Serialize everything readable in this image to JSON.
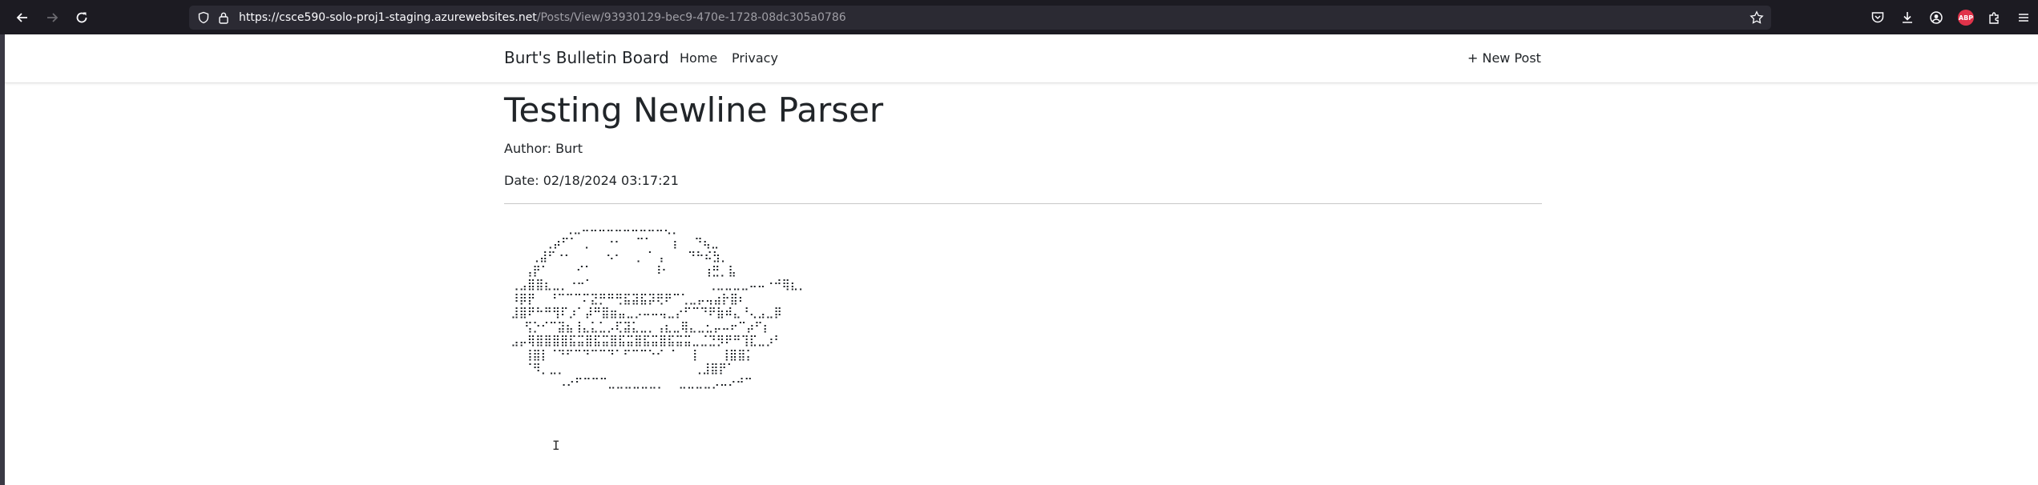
{
  "browser": {
    "url_host": "https://csce590-solo-proj1-staging.azurewebsites.net",
    "url_path": "/Posts/View/93930129-bec9-470e-1728-08dc305a0786",
    "toolbar_icons": [
      "back-icon",
      "forward-icon",
      "reload-icon",
      "shield-icon",
      "lock-icon",
      "bookmark-star-icon",
      "pocket-icon",
      "download-icon",
      "account-icon",
      "adblock-plus-icon",
      "extensions-icon",
      "menu-icon"
    ],
    "abp_label": "ABP"
  },
  "site": {
    "brand": "Burt's Bulletin Board",
    "nav": {
      "home": "Home",
      "privacy": "Privacy",
      "new_post": "+ New Post"
    }
  },
  "post": {
    "title": "Testing Newline Parser",
    "author": "Author: Burt",
    "date": "Date: 02/18/2024 03:17:21",
    "ascii_art": "         ⢀⣀⠤⠤⠤⠤⠤⠤⠤⠤⠤⠤⢄⡀\n      ⢀⡴⠋⠁ ⡀  ⠐⠂  ⠉⠁   ⡆  ⠙⢦⣀\n    ⢀⣼⠋⠐⠂     ⠢⠂  ⡀⠈ ⡄   ⠙⠓⠮⣳⡀\n   ⢠⡟⠁    ⠊⠁         ⠸⠂     ⢰⣛⡀⣧\n ⢀⣠⣿⣿⣆⣀⡀⠐⠒⠁                 ⢀⣀⣀⣀⣀⠤⠤⠐⠚⢿⣆⡀\n ⠸⡿⡟  ⠘⠉⠉⠉⠍⣝⡛⠛⢛⣯⣽⣯⡽⢟⠟⠉⢁⣀⡤⢤⣴⡗⣿⠆\n ⣸⣿⠟⠓⠛⢻⠏⡰⠁⡼⠛⣿⣶⣤⣀⡠⠤⠤⢤⣀⡔⠋⠉⠙⠟⣷⠾⣄⠘⢄⣠⣀⡿\n   ⢫⡑⠊⠉⣽⣦⢸⣄⣅⣁⡠⢏⣽⣅⣀⡀⢠⣆⣀⢿⣄⣀⣂⡤⠤⠖⠉⡴⠋⡆\n ⣠⡤⢿⣿⣿⣿⣿⣯⣭⣿⣯⣭⣿⣯⣭⣿⣯⣭⣿⣯⣭⣭⣀⣈⣙⡻⠟⠛⢹⣏⣀⡰⠃\n   ⢸⣿⡇⠈⠙⠋⠉⠙⠉⠉⠙⠁⠋⠉⠉⠑⠊ ⠁  ⡇   ⢸⣿⣿⡅\n   ⠈⠻⡀⣀⡀                   ⢀⣸⣿⡟⠁\n        ⠠⠔⠋⠉⠉⠉⣀⣀⣀⣀⣀⣀⡀  ⣀⣀⣀⣀⡠⠤⠔⠚⠉"
  }
}
